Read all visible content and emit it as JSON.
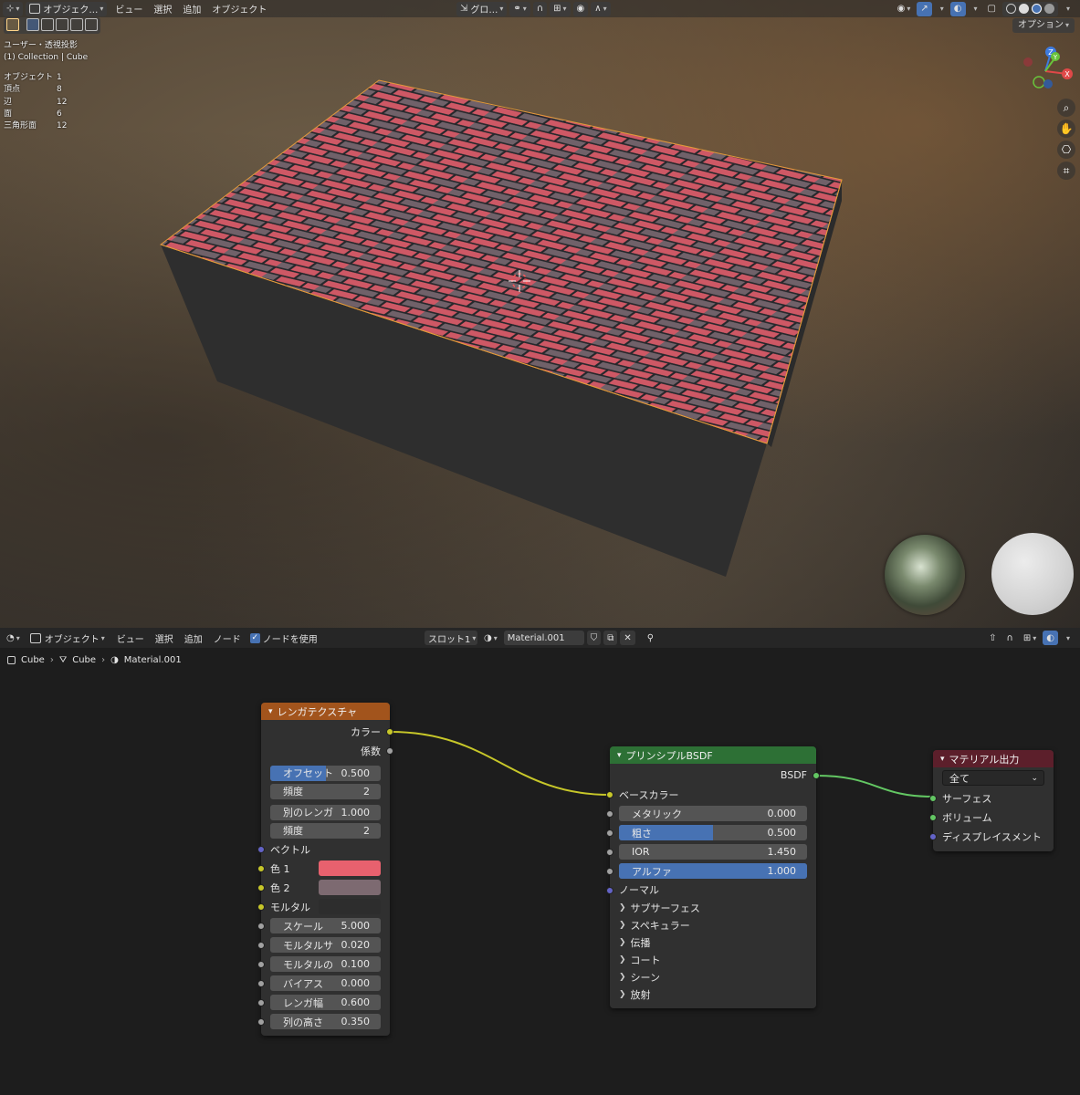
{
  "viewport": {
    "header": {
      "mode": "オブジェク…",
      "menu": [
        "ビュー",
        "選択",
        "追加",
        "オブジェクト"
      ],
      "transform_orientation": "グロ…",
      "options": "オプション"
    },
    "overlay": {
      "view_name": "ユーザー・透視投影",
      "collection": "(1) Collection | Cube",
      "stats": [
        {
          "label": "オブジェクト",
          "value": "1"
        },
        {
          "label": "頂点",
          "value": "8"
        },
        {
          "label": "辺",
          "value": "12"
        },
        {
          "label": "面",
          "value": "6"
        },
        {
          "label": "三角形面",
          "value": "12"
        }
      ]
    },
    "gizmo": {
      "x": "X",
      "y": "Y",
      "z": "Z"
    },
    "brick_colors": {
      "color1": "#e0606e",
      "color2": "#7a6a72",
      "mortar": "#2a2c30",
      "side": "#2e2e2e"
    }
  },
  "node_editor": {
    "header": {
      "mode": "オブジェクト",
      "menu": [
        "ビュー",
        "選択",
        "追加",
        "ノード"
      ],
      "use_nodes": "ノードを使用",
      "slot": "スロット1",
      "material": "Material.001"
    },
    "breadcrumb": [
      "Cube",
      "Cube",
      "Material.001"
    ],
    "brick_node": {
      "title": "レンガテクスチャ",
      "outputs": [
        "カラー",
        "係数"
      ],
      "fields1": [
        {
          "label": "オフセット",
          "value": "0.500",
          "fill": 0.5
        },
        {
          "label": "頻度",
          "value": "2",
          "fill": 0
        }
      ],
      "fields2": [
        {
          "label": "別のレンガ",
          "value": "1.000",
          "fill": 0
        },
        {
          "label": "頻度",
          "value": "2",
          "fill": 0
        }
      ],
      "vector": "ベクトル",
      "color1": {
        "label": "色 1",
        "color": "#e8616e"
      },
      "color2": {
        "label": "色 2",
        "color": "#7d6a71"
      },
      "mortar": {
        "label": "モルタル",
        "color": "#2d2d2d"
      },
      "fields3": [
        {
          "label": "スケール",
          "value": "5.000"
        },
        {
          "label": "モルタルサ",
          "value": "0.020"
        },
        {
          "label": "モルタルの",
          "value": "0.100"
        },
        {
          "label": "バイアス",
          "value": "0.000"
        },
        {
          "label": "レンガ幅",
          "value": "0.600"
        },
        {
          "label": "列の高さ",
          "value": "0.350"
        }
      ]
    },
    "bsdf_node": {
      "title": "プリンシプルBSDF",
      "output": "BSDF",
      "base_color": "ベースカラー",
      "fields": [
        {
          "label": "メタリック",
          "value": "0.000",
          "fill": 0
        },
        {
          "label": "粗さ",
          "value": "0.500",
          "fill": 0.5
        },
        {
          "label": "IOR",
          "value": "1.450",
          "fill": 0
        },
        {
          "label": "アルファ",
          "value": "1.000",
          "fill": 1
        }
      ],
      "normal": "ノーマル",
      "panels": [
        "サブサーフェス",
        "スペキュラー",
        "伝播",
        "コート",
        "シーン",
        "放射"
      ]
    },
    "output_node": {
      "title": "マテリアル出力",
      "target": "全て",
      "inputs": [
        "サーフェス",
        "ボリューム",
        "ディスプレイスメント"
      ]
    }
  }
}
